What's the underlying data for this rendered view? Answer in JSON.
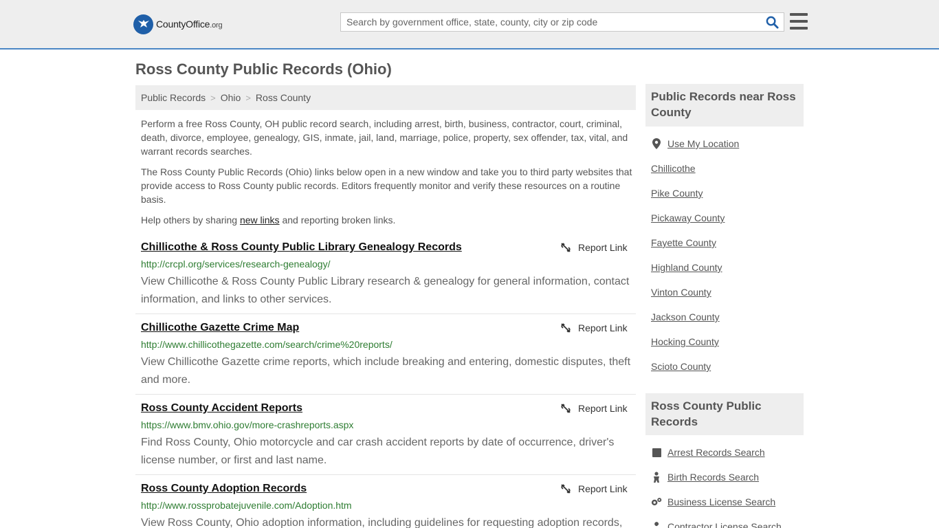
{
  "header": {
    "logo_main": "CountyOffice",
    "logo_suffix": ".org",
    "search_placeholder": "Search by government office, state, county, city or zip code"
  },
  "page": {
    "title": "Ross County Public Records (Ohio)"
  },
  "breadcrumb": [
    "Public Records",
    "Ohio",
    "Ross County"
  ],
  "intro": {
    "p1": "Perform a free Ross County, OH public record search, including arrest, birth, business, contractor, court, criminal, death, divorce, employee, genealogy, GIS, inmate, jail, land, marriage, police, property, sex offender, tax, vital, and warrant records searches.",
    "p2": "The Ross County Public Records (Ohio) links below open in a new window and take you to third party websites that provide access to Ross County public records. Editors frequently monitor and verify these resources on a routine basis.",
    "p3_before": "Help others by sharing ",
    "p3_link": "new links",
    "p3_after": " and reporting broken links."
  },
  "report_label": "Report Link",
  "records": [
    {
      "title": "Chillicothe & Ross County Public Library Genealogy Records",
      "url": "http://crcpl.org/services/research-genealogy/",
      "desc": "View Chillicothe & Ross County Public Library research & genealogy for general information, contact information, and links to other services."
    },
    {
      "title": "Chillicothe Gazette Crime Map",
      "url": "http://www.chillicothegazette.com/search/crime%20reports/",
      "desc": "View Chillicothe Gazette crime reports, which include breaking and entering, domestic disputes, theft and more."
    },
    {
      "title": "Ross County Accident Reports",
      "url": "https://www.bmv.ohio.gov/more-crashreports.aspx",
      "desc": "Find Ross County, Ohio motorcycle and car crash accident reports by date of occurrence, driver's license number, or first and last name."
    },
    {
      "title": "Ross County Adoption Records",
      "url": "http://www.rossprobatejuvenile.com/Adoption.htm",
      "desc": "View Ross County, Ohio adoption information, including guidelines for requesting adoption records,"
    }
  ],
  "sidebar": {
    "nearby_heading": "Public Records near Ross County",
    "use_location": "Use My Location",
    "nearby": [
      "Chillicothe",
      "Pike County",
      "Pickaway County",
      "Fayette County",
      "Highland County",
      "Vinton County",
      "Jackson County",
      "Hocking County",
      "Scioto County"
    ],
    "records_heading": "Ross County Public Records",
    "record_links": [
      {
        "label": "Arrest Records Search",
        "icon": "square-icon"
      },
      {
        "label": "Birth Records Search",
        "icon": "baby-icon"
      },
      {
        "label": "Business License Search",
        "icon": "gears-icon"
      },
      {
        "label": "Contractor License Search",
        "icon": "wrench-icon"
      }
    ]
  },
  "colors": {
    "accent": "#4a86c5",
    "url_green": "#2e7d32",
    "search_icon": "#1f5fa8"
  }
}
